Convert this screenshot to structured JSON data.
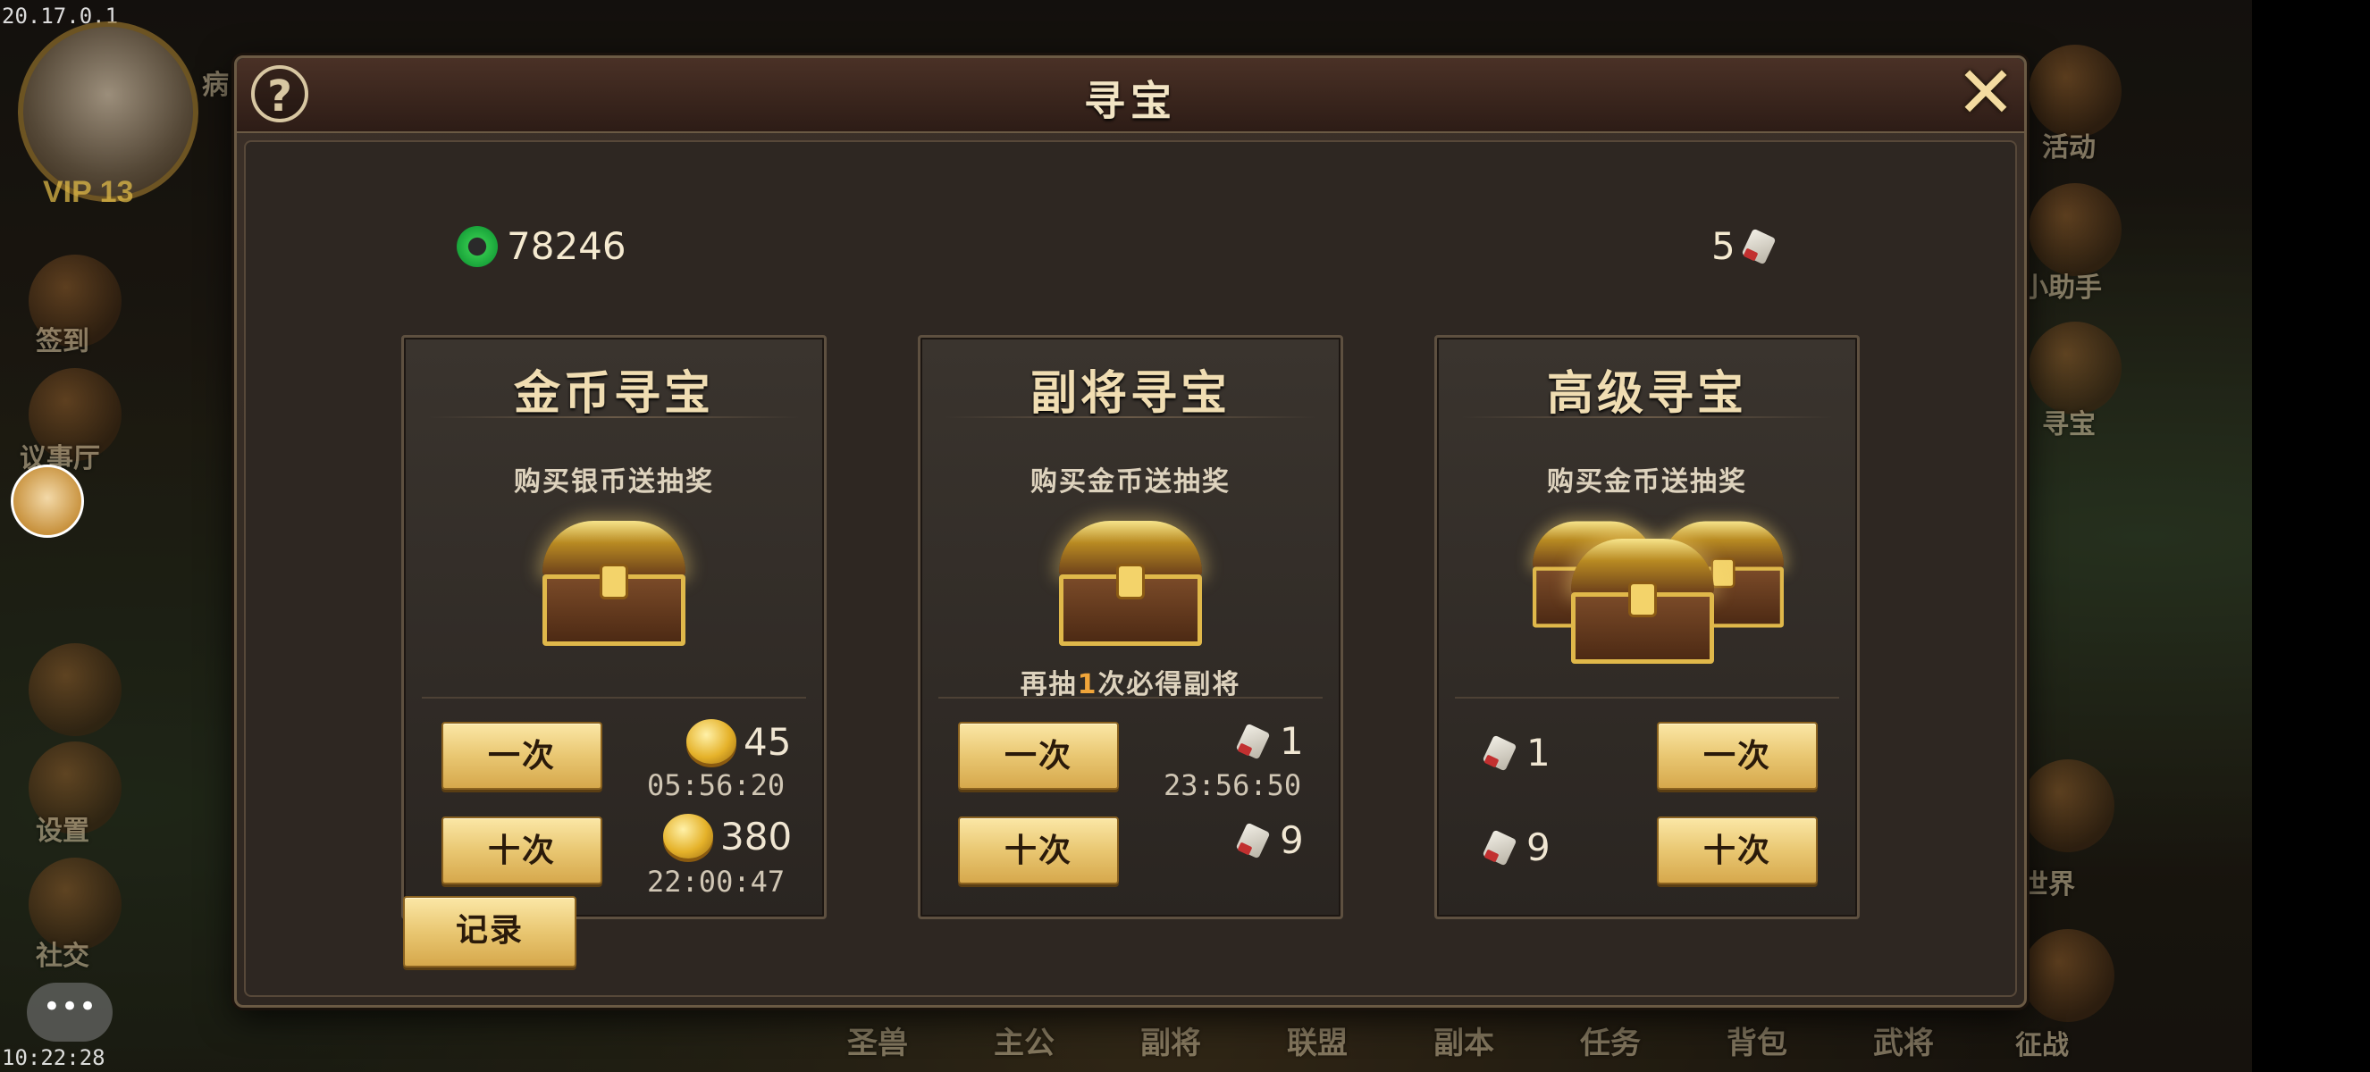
{
  "hud": {
    "version": "20.17.0.1",
    "clock": "10:22:28",
    "vip": "VIP 13",
    "top_partial": "病"
  },
  "left_side": [
    "签到",
    "议事厅",
    "设置",
    "社交"
  ],
  "right_side": [
    "活动",
    "小助手",
    "寻宝",
    "世界",
    "征战"
  ],
  "bottom_nav": [
    "圣兽",
    "主公",
    "副将",
    "联盟",
    "副本",
    "任务",
    "背包",
    "武将"
  ],
  "chat_label": "•••",
  "dialog": {
    "title": "寻宝",
    "help_label": "?",
    "close_label": "✕",
    "jade_balance": "78246",
    "scroll_balance": "5",
    "record_label": "记录"
  },
  "cards": [
    {
      "title": "金币寻宝",
      "subtitle": "购买银币送抽奖",
      "once_label": "一次",
      "ten_label": "十次",
      "once_cost": "45",
      "once_timer": "05:56:20",
      "ten_cost": "380",
      "ten_timer": "22:00:47"
    },
    {
      "title": "副将寻宝",
      "subtitle": "购买金币送抽奖",
      "guarantee_pre": "再抽",
      "guarantee_num": "1",
      "guarantee_post": "次必得副将",
      "once_label": "一次",
      "ten_label": "十次",
      "once_cost": "1",
      "once_timer": "23:56:50",
      "ten_cost": "9"
    },
    {
      "title": "高级寻宝",
      "subtitle": "购买金币送抽奖",
      "once_label": "一次",
      "ten_label": "十次",
      "once_cost": "1",
      "ten_cost": "9"
    }
  ]
}
